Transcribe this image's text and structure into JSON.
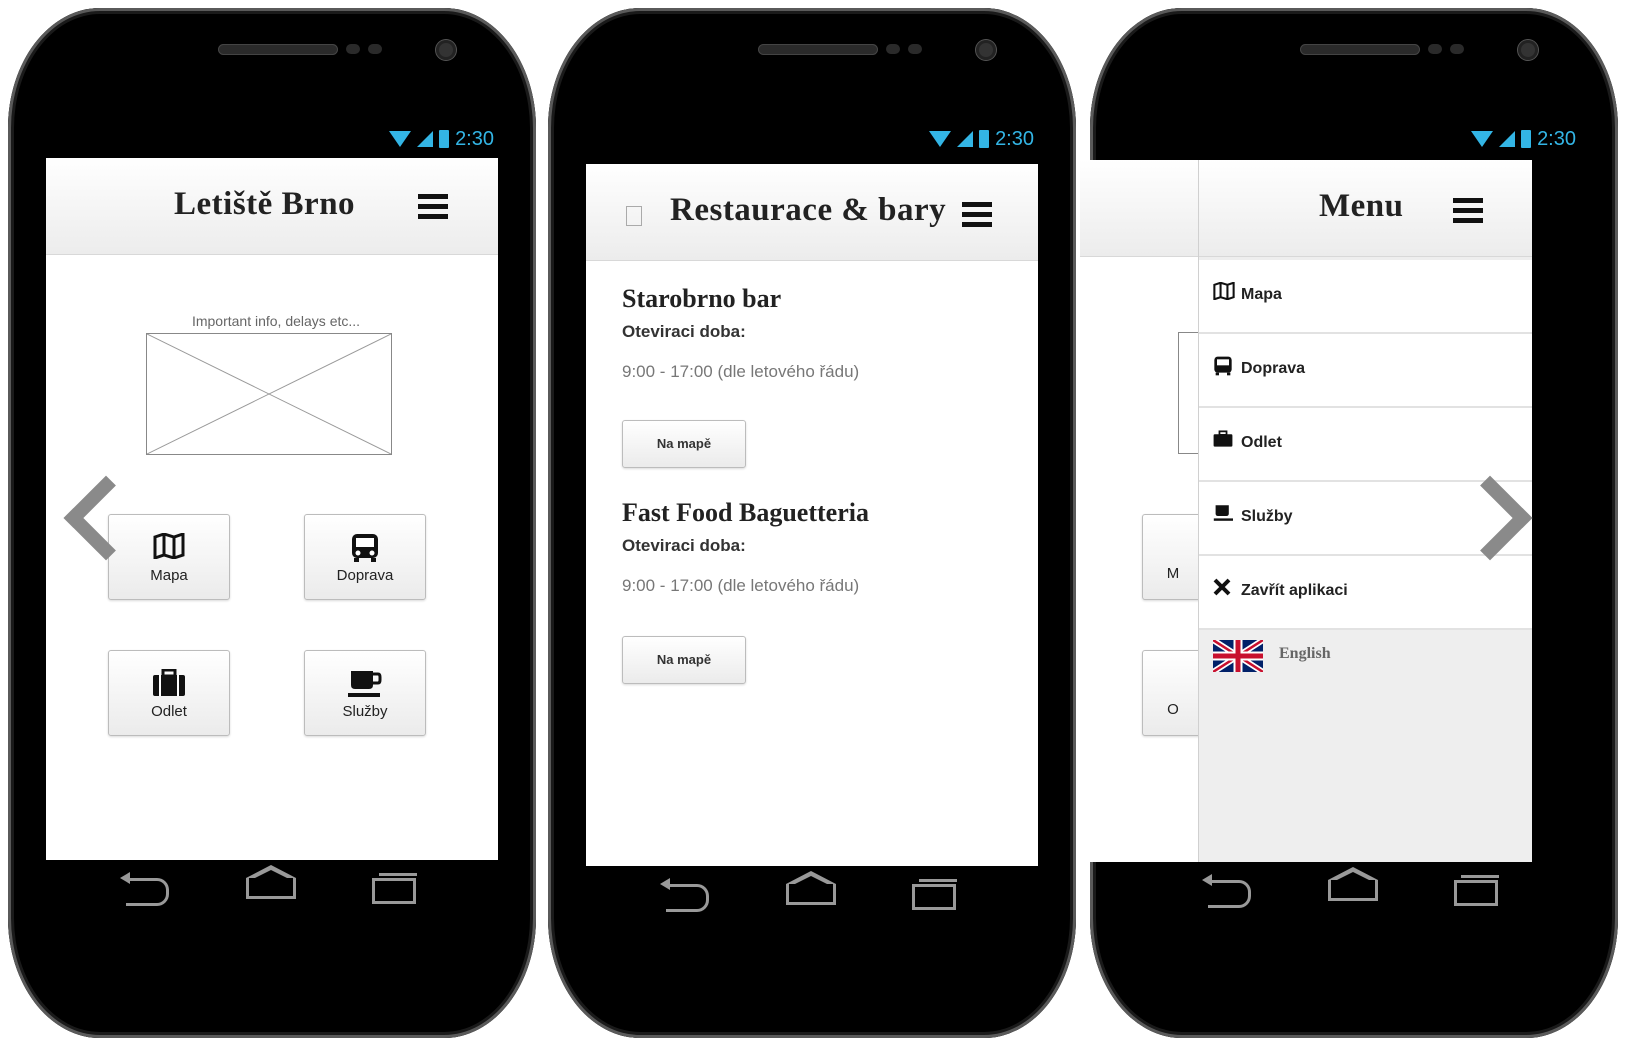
{
  "status": {
    "time": "2:30"
  },
  "home": {
    "title": "Letiště Brno",
    "info_label": "Important info, delays etc...",
    "tiles": [
      {
        "icon": "map-icon",
        "label": "Mapa"
      },
      {
        "icon": "bus-icon",
        "label": "Doprava"
      },
      {
        "icon": "briefcase-icon",
        "label": "Odlet"
      },
      {
        "icon": "coffee-icon",
        "label": "Služby"
      }
    ]
  },
  "restaurants": {
    "title": "Restaurace & bary",
    "items": [
      {
        "name": "Starobrno bar",
        "hours_label": "Oteviraci doba:",
        "hours": "9:00 - 17:00 (dle letového řádu)",
        "button": "Na mapě"
      },
      {
        "name": "Fast Food Baguetteria",
        "hours_label": "Oteviraci doba:",
        "hours": "9:00 - 17:00 (dle letového řádu)",
        "button": "Na mapě"
      }
    ]
  },
  "menu": {
    "title": "Menu",
    "items": [
      {
        "icon": "map-icon",
        "label": "Mapa"
      },
      {
        "icon": "bus-icon",
        "label": "Doprava"
      },
      {
        "icon": "briefcase-icon",
        "label": "Odlet"
      },
      {
        "icon": "coffee-icon",
        "label": "Služby"
      },
      {
        "icon": "close-icon",
        "label": "Zavřít aplikaci"
      }
    ],
    "language": "English",
    "partial_tiles": [
      "M",
      "O"
    ]
  },
  "colors": {
    "status_blue": "#33b5e5",
    "arrow_gray": "#8a8a8a"
  }
}
